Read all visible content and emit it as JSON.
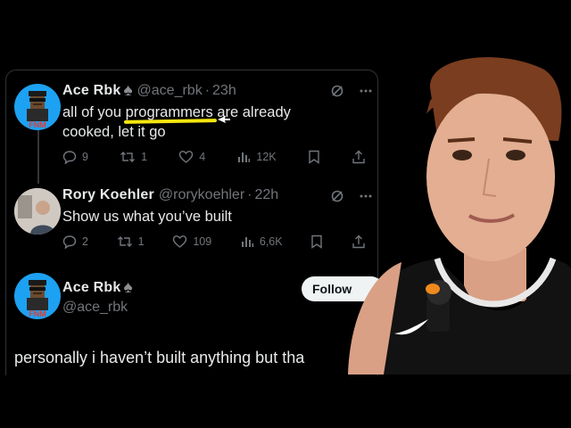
{
  "tweets": [
    {
      "name": "Ace Rbk",
      "handle": "@ace_rbk",
      "time": "23h",
      "avatar_caption": "FNM",
      "text_before": "all of you ",
      "text_highlight": "programmers",
      "text_after": " are already",
      "text_line2": "cooked, let it go",
      "replies": "9",
      "reposts": "1",
      "likes": "4",
      "views": "12K"
    },
    {
      "name": "Rory Koehler",
      "handle": "@rorykoehler",
      "time": "22h",
      "text": "Show us what you’ve built",
      "replies": "2",
      "reposts": "1",
      "likes": "109",
      "views": "6,6K"
    }
  ],
  "main_post": {
    "name": "Ace Rbk",
    "handle": "@ace_rbk",
    "avatar_caption": "FNM",
    "follow_label": "Follow",
    "text": "personally i haven’t built anything but tha"
  },
  "colors": {
    "background": "#000000",
    "text": "#e7e9ea",
    "muted": "#71767b",
    "avatar_blue": "#1da1f2",
    "highlight": "#f5e60f"
  },
  "icons": [
    "spade-icon",
    "grok-icon",
    "more-icon",
    "reply-icon",
    "repost-icon",
    "like-icon",
    "views-icon",
    "bookmark-icon",
    "share-icon"
  ]
}
